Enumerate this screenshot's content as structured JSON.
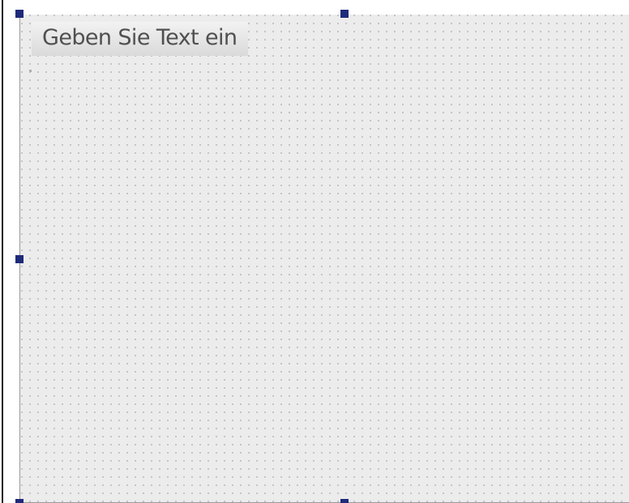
{
  "form": {
    "menu_placeholder": "Geben Sie Text ein"
  },
  "colors": {
    "canvas": "#ececec",
    "grid_dot": "#b9b9c4",
    "handle": "#1f2a7a",
    "menu_text": "#505050"
  },
  "icons": {
    "selection_handles": "square-handle-icon"
  }
}
